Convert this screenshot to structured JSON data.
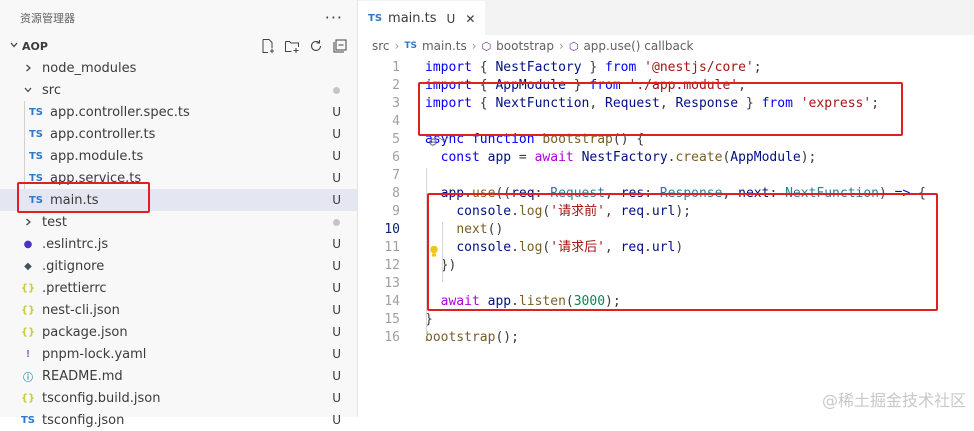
{
  "explorer": {
    "title": "资源管理器",
    "more": "···",
    "project": "AOP",
    "actions": [
      "new-file-icon",
      "new-folder-icon",
      "refresh-icon",
      "collapse-icon"
    ]
  },
  "tree": [
    {
      "icon": ">",
      "label": "node_modules",
      "indent": 20,
      "status": "",
      "dot": false,
      "kind": "chevron"
    },
    {
      "icon": "v",
      "label": "src",
      "indent": 20,
      "status": "",
      "dot": true,
      "kind": "chevron"
    },
    {
      "icon": "TS",
      "label": "app.controller.spec.ts",
      "indent": 28,
      "status": "U",
      "dot": false,
      "kind": "ts"
    },
    {
      "icon": "TS",
      "label": "app.controller.ts",
      "indent": 28,
      "status": "U",
      "dot": false,
      "kind": "ts"
    },
    {
      "icon": "TS",
      "label": "app.module.ts",
      "indent": 28,
      "status": "U",
      "dot": false,
      "kind": "ts"
    },
    {
      "icon": "TS",
      "label": "app.service.ts",
      "indent": 28,
      "status": "U",
      "dot": false,
      "kind": "ts"
    },
    {
      "icon": "TS",
      "label": "main.ts",
      "indent": 28,
      "status": "U",
      "dot": false,
      "kind": "ts",
      "selected": true
    },
    {
      "icon": ">",
      "label": "test",
      "indent": 20,
      "status": "",
      "dot": true,
      "kind": "chevron"
    },
    {
      "icon": "●",
      "label": ".eslintrc.js",
      "indent": 20,
      "status": "U",
      "dot": false,
      "kind": "eslint"
    },
    {
      "icon": "◆",
      "label": ".gitignore",
      "indent": 20,
      "status": "U",
      "dot": false,
      "kind": "git"
    },
    {
      "icon": "{}",
      "label": ".prettierrc",
      "indent": 20,
      "status": "U",
      "dot": false,
      "kind": "json"
    },
    {
      "icon": "{}",
      "label": "nest-cli.json",
      "indent": 20,
      "status": "U",
      "dot": false,
      "kind": "json"
    },
    {
      "icon": "{}",
      "label": "package.json",
      "indent": 20,
      "status": "U",
      "dot": false,
      "kind": "json"
    },
    {
      "icon": "!",
      "label": "pnpm-lock.yaml",
      "indent": 20,
      "status": "U",
      "dot": false,
      "kind": "yaml"
    },
    {
      "icon": "ⓘ",
      "label": "README.md",
      "indent": 20,
      "status": "U",
      "dot": false,
      "kind": "md"
    },
    {
      "icon": "{}",
      "label": "tsconfig.build.json",
      "indent": 20,
      "status": "U",
      "dot": false,
      "kind": "json"
    },
    {
      "icon": "TS",
      "label": "tsconfig.json",
      "indent": 20,
      "status": "U",
      "dot": false,
      "kind": "ts"
    }
  ],
  "tab": {
    "badge": "TS",
    "name": "main.ts",
    "status": "U",
    "close": "✕"
  },
  "breadcrumb": {
    "folder": "src",
    "file": "main.ts",
    "sym1": "bootstrap",
    "sym2": "app.use() callback"
  },
  "colors": {
    "red_box": "#e02020",
    "ts": "#3178c6"
  },
  "code_lines": [
    {
      "n": "1",
      "parts": [
        [
          "kw",
          "import"
        ],
        [
          "plain",
          " { "
        ],
        [
          "id",
          "NestFactory"
        ],
        [
          "plain",
          " } "
        ],
        [
          "kw",
          "from"
        ],
        [
          "plain",
          " "
        ],
        [
          "str",
          "'@nestjs/core'"
        ],
        [
          "plain",
          ";"
        ]
      ]
    },
    {
      "n": "2",
      "parts": [
        [
          "kw",
          "import"
        ],
        [
          "plain",
          " { "
        ],
        [
          "id",
          "AppModule"
        ],
        [
          "plain",
          " } "
        ],
        [
          "kw",
          "from"
        ],
        [
          "plain",
          " "
        ],
        [
          "str",
          "'./app.module'"
        ],
        [
          "plain",
          ";"
        ]
      ]
    },
    {
      "n": "3",
      "parts": [
        [
          "kw",
          "import"
        ],
        [
          "plain",
          " { "
        ],
        [
          "id",
          "NextFunction"
        ],
        [
          "plain",
          ", "
        ],
        [
          "id",
          "Request"
        ],
        [
          "plain",
          ", "
        ],
        [
          "id",
          "Response"
        ],
        [
          "plain",
          " } "
        ],
        [
          "kw",
          "from"
        ],
        [
          "plain",
          " "
        ],
        [
          "str",
          "'express'"
        ],
        [
          "plain",
          ";"
        ]
      ]
    },
    {
      "n": "4",
      "parts": []
    },
    {
      "n": "5",
      "parts": [
        [
          "kw",
          "async"
        ],
        [
          "plain",
          " "
        ],
        [
          "kw",
          "function"
        ],
        [
          "plain",
          " "
        ],
        [
          "fn",
          "bootstrap"
        ],
        [
          "plain",
          "() {"
        ]
      ]
    },
    {
      "n": "6",
      "parts": [
        [
          "plain",
          "  "
        ],
        [
          "kw",
          "const"
        ],
        [
          "plain",
          " "
        ],
        [
          "id",
          "app"
        ],
        [
          "plain",
          " = "
        ],
        [
          "ctl",
          "await"
        ],
        [
          "plain",
          " "
        ],
        [
          "id",
          "NestFactory"
        ],
        [
          "plain",
          "."
        ],
        [
          "fn",
          "create"
        ],
        [
          "plain",
          "("
        ],
        [
          "id",
          "AppModule"
        ],
        [
          "plain",
          ");"
        ]
      ]
    },
    {
      "n": "7",
      "parts": []
    },
    {
      "n": "8",
      "parts": [
        [
          "plain",
          "  "
        ],
        [
          "id",
          "app"
        ],
        [
          "plain",
          "."
        ],
        [
          "fn",
          "use"
        ],
        [
          "plain",
          "(("
        ],
        [
          "id",
          "req"
        ],
        [
          "plain",
          ": "
        ],
        [
          "cls",
          "Request"
        ],
        [
          "plain",
          ", "
        ],
        [
          "id",
          "res"
        ],
        [
          "plain",
          ": "
        ],
        [
          "cls",
          "Response"
        ],
        [
          "plain",
          ", "
        ],
        [
          "id",
          "next"
        ],
        [
          "plain",
          ": "
        ],
        [
          "cls",
          "NextFunction"
        ],
        [
          "plain",
          ") "
        ],
        [
          "kw",
          "=>"
        ],
        [
          "plain",
          " {"
        ]
      ]
    },
    {
      "n": "9",
      "parts": [
        [
          "plain",
          "    "
        ],
        [
          "id",
          "console"
        ],
        [
          "plain",
          "."
        ],
        [
          "fn",
          "log"
        ],
        [
          "plain",
          "("
        ],
        [
          "str",
          "'请求前'"
        ],
        [
          "plain",
          ", "
        ],
        [
          "id",
          "req"
        ],
        [
          "plain",
          "."
        ],
        [
          "id",
          "url"
        ],
        [
          "plain",
          ");"
        ]
      ]
    },
    {
      "n": "10",
      "parts": [
        [
          "plain",
          "    "
        ],
        [
          "fn",
          "next"
        ],
        [
          "plain",
          "()"
        ]
      ]
    },
    {
      "n": "11",
      "parts": [
        [
          "plain",
          "    "
        ],
        [
          "id",
          "console"
        ],
        [
          "plain",
          "."
        ],
        [
          "fn",
          "log"
        ],
        [
          "plain",
          "("
        ],
        [
          "str",
          "'请求后'"
        ],
        [
          "plain",
          ", "
        ],
        [
          "id",
          "req"
        ],
        [
          "plain",
          "."
        ],
        [
          "id",
          "url"
        ],
        [
          "plain",
          ")"
        ]
      ]
    },
    {
      "n": "12",
      "parts": [
        [
          "plain",
          "  })"
        ]
      ]
    },
    {
      "n": "13",
      "parts": []
    },
    {
      "n": "14",
      "parts": [
        [
          "plain",
          "  "
        ],
        [
          "ctl",
          "await"
        ],
        [
          "plain",
          " "
        ],
        [
          "id",
          "app"
        ],
        [
          "plain",
          "."
        ],
        [
          "fn",
          "listen"
        ],
        [
          "plain",
          "("
        ],
        [
          "num",
          "3000"
        ],
        [
          "plain",
          ");"
        ]
      ]
    },
    {
      "n": "15",
      "parts": [
        [
          "plain",
          "}"
        ]
      ]
    },
    {
      "n": "16",
      "parts": [
        [
          "fn",
          "bootstrap"
        ],
        [
          "plain",
          "();"
        ]
      ]
    }
  ],
  "active_line": "10",
  "watermark": "@稀土掘金技术社区"
}
